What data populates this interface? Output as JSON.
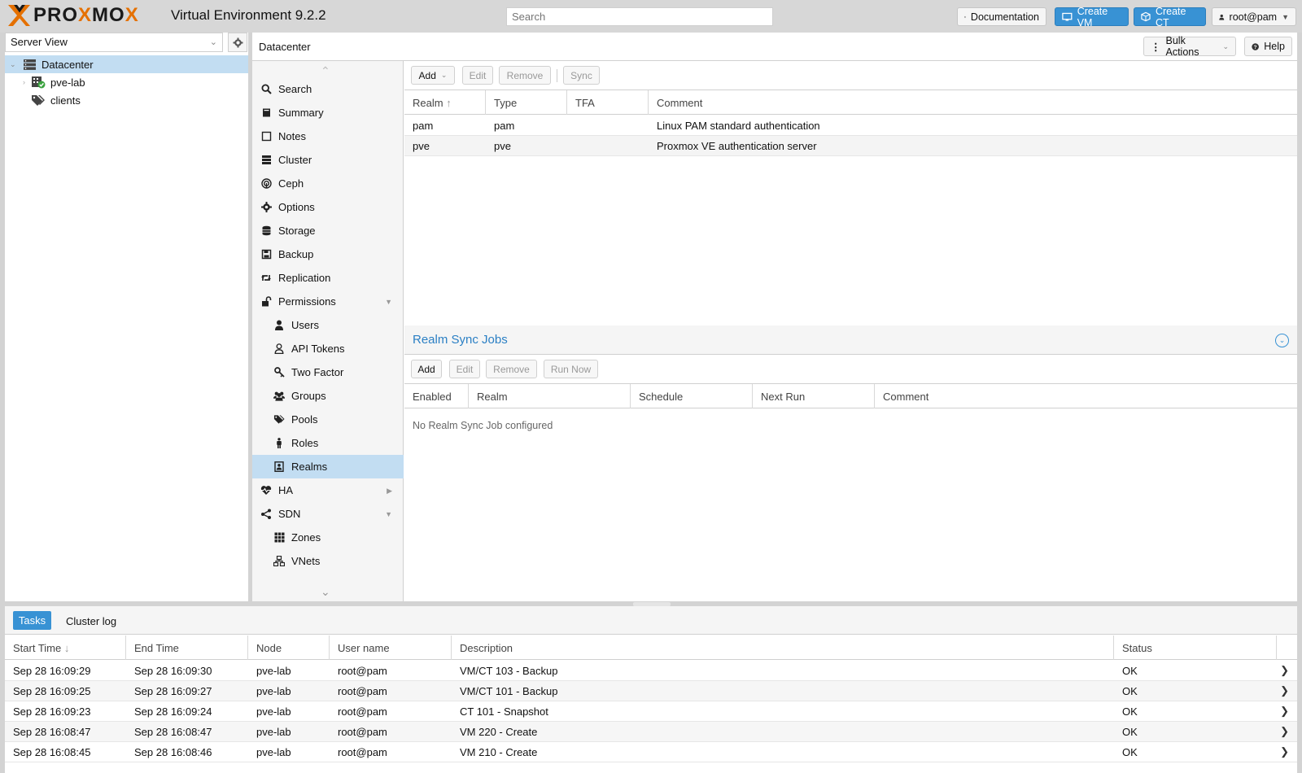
{
  "header": {
    "brand_prefix": "PRO",
    "brand_x": "X",
    "brand_suffix": "MO",
    "brand_x2": "X",
    "product": "Virtual Environment 9.2.2",
    "search_placeholder": "Search",
    "documentation": "Documentation",
    "create_vm": "Create VM",
    "create_ct": "Create CT",
    "user": "root@pam"
  },
  "left": {
    "view": "Server View",
    "tree": [
      {
        "label": "Datacenter",
        "icon": "datacenter-icon",
        "selected": true
      },
      {
        "label": "pve-lab",
        "icon": "node-online-icon"
      },
      {
        "label": "clients",
        "icon": "tags-icon"
      }
    ]
  },
  "content": {
    "title": "Datacenter",
    "bulk_actions": "Bulk Actions",
    "help": "Help"
  },
  "menu": [
    {
      "label": "Search",
      "icon": "search-icon"
    },
    {
      "label": "Summary",
      "icon": "book-icon"
    },
    {
      "label": "Notes",
      "icon": "notes-icon"
    },
    {
      "label": "Cluster",
      "icon": "server-icon"
    },
    {
      "label": "Ceph",
      "icon": "ceph-icon"
    },
    {
      "label": "Options",
      "icon": "gear-icon"
    },
    {
      "label": "Storage",
      "icon": "database-icon"
    },
    {
      "label": "Backup",
      "icon": "floppy-icon"
    },
    {
      "label": "Replication",
      "icon": "retweet-icon"
    },
    {
      "label": "Permissions",
      "icon": "unlock-icon",
      "expandable": "down"
    },
    {
      "label": "Users",
      "icon": "user-icon",
      "sub": true
    },
    {
      "label": "API Tokens",
      "icon": "user-outline-icon",
      "sub": true
    },
    {
      "label": "Two Factor",
      "icon": "key-icon",
      "sub": true
    },
    {
      "label": "Groups",
      "icon": "users-icon",
      "sub": true
    },
    {
      "label": "Pools",
      "icon": "tags-icon",
      "sub": true
    },
    {
      "label": "Roles",
      "icon": "male-icon",
      "sub": true
    },
    {
      "label": "Realms",
      "icon": "address-book-icon",
      "sub": true,
      "selected": true
    },
    {
      "label": "HA",
      "icon": "heartbeat-icon",
      "expandable": "right"
    },
    {
      "label": "SDN",
      "icon": "sdn-icon",
      "expandable": "down"
    },
    {
      "label": "Zones",
      "icon": "grid-icon",
      "sub": true
    },
    {
      "label": "VNets",
      "icon": "network-icon",
      "sub": true
    }
  ],
  "realms": {
    "toolbar": {
      "add": "Add",
      "edit": "Edit",
      "remove": "Remove",
      "sync": "Sync"
    },
    "columns": [
      "Realm",
      "Type",
      "TFA",
      "Comment"
    ],
    "rows": [
      {
        "realm": "pam",
        "type": "pam",
        "tfa": "",
        "comment": "Linux PAM standard authentication"
      },
      {
        "realm": "pve",
        "type": "pve",
        "tfa": "",
        "comment": "Proxmox VE authentication server"
      }
    ]
  },
  "sync_jobs": {
    "title": "Realm Sync Jobs",
    "toolbar": {
      "add": "Add",
      "edit": "Edit",
      "remove": "Remove",
      "run_now": "Run Now"
    },
    "columns": [
      "Enabled",
      "Realm",
      "Schedule",
      "Next Run",
      "Comment"
    ],
    "empty": "No Realm Sync Job configured"
  },
  "tasks": {
    "tab_tasks": "Tasks",
    "tab_cluster_log": "Cluster log",
    "columns": [
      "Start Time",
      "End Time",
      "Node",
      "User name",
      "Description",
      "Status"
    ],
    "rows": [
      {
        "start": "Sep 28 16:09:29",
        "end": "Sep 28 16:09:30",
        "node": "pve-lab",
        "user": "root@pam",
        "desc": "VM/CT 103 - Backup",
        "status": "OK"
      },
      {
        "start": "Sep 28 16:09:25",
        "end": "Sep 28 16:09:27",
        "node": "pve-lab",
        "user": "root@pam",
        "desc": "VM/CT 101 - Backup",
        "status": "OK"
      },
      {
        "start": "Sep 28 16:09:23",
        "end": "Sep 28 16:09:24",
        "node": "pve-lab",
        "user": "root@pam",
        "desc": "CT 101 - Snapshot",
        "status": "OK"
      },
      {
        "start": "Sep 28 16:08:47",
        "end": "Sep 28 16:08:47",
        "node": "pve-lab",
        "user": "root@pam",
        "desc": "VM 220 - Create",
        "status": "OK"
      },
      {
        "start": "Sep 28 16:08:45",
        "end": "Sep 28 16:08:46",
        "node": "pve-lab",
        "user": "root@pam",
        "desc": "VM 210 - Create",
        "status": "OK"
      }
    ]
  },
  "colors": {
    "accent": "#3892d4",
    "brand_orange": "#e57000",
    "selection": "#c2ddf2"
  }
}
